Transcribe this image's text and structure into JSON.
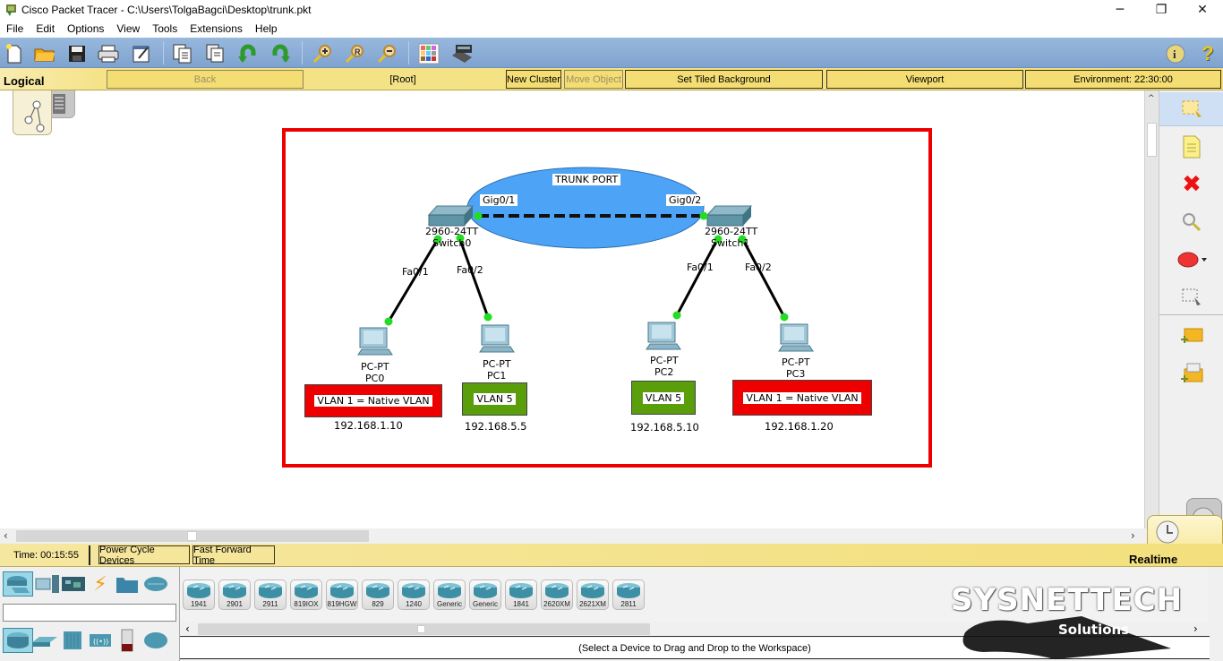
{
  "window": {
    "title": "Cisco Packet Tracer - C:\\Users\\TolgaBagci\\Desktop\\trunk.pkt",
    "controls": {
      "minimize": "─",
      "restore": "❐",
      "close": "✕"
    }
  },
  "menu": [
    "File",
    "Edit",
    "Options",
    "View",
    "Tools",
    "Extensions",
    "Help"
  ],
  "toolbar": {
    "buttons": [
      "new-file",
      "open-folder",
      "save",
      "print",
      "activity-wizard",
      "copy",
      "paste",
      "undo",
      "redo",
      "zoom-in",
      "zoom-reset",
      "zoom-out",
      "palette",
      "custom-device"
    ],
    "info_label": "i",
    "help_label": "?"
  },
  "logical_bar": {
    "label": "Logical",
    "back": "Back",
    "root": "[Root]",
    "new_cluster": "New Cluster",
    "move_object": "Move Object",
    "set_tiled_background": "Set Tiled Background",
    "viewport": "Viewport",
    "environment": "Environment: 22:30:00"
  },
  "topology": {
    "trunk_label": "TRUNK PORT",
    "switches": [
      {
        "model": "2960-24TT",
        "name": "Switch0",
        "uplink": "Gig0/1",
        "ports": [
          "Fa0/1",
          "Fa0/2"
        ]
      },
      {
        "model": "2960-24TT",
        "name": "Switch1",
        "uplink": "Gig0/2",
        "ports": [
          "Fa0/1",
          "Fa0/2"
        ]
      }
    ],
    "pcs": [
      {
        "model": "PC-PT",
        "name": "PC0",
        "vlan": "VLAN 1 = Native VLAN",
        "ip": "192.168.1.10",
        "color": "#ee0000"
      },
      {
        "model": "PC-PT",
        "name": "PC1",
        "vlan": "VLAN 5",
        "ip": "192.168.5.5",
        "color": "#5a9e0c"
      },
      {
        "model": "PC-PT",
        "name": "PC2",
        "vlan": "VLAN 5",
        "ip": "192.168.5.10",
        "color": "#5a9e0c"
      },
      {
        "model": "PC-PT",
        "name": "PC3",
        "vlan": "VLAN 1 = Native VLAN",
        "ip": "192.168.1.20",
        "color": "#ee0000"
      }
    ],
    "colors": {
      "frame": "#ee0000",
      "trunk_ellipse": "#4da3f5",
      "link_up": "#22dd22"
    }
  },
  "right_tools": [
    "select",
    "note",
    "delete",
    "inspect",
    "draw-ellipse",
    "resize",
    "add-simple-pdu",
    "add-complex-pdu"
  ],
  "status": {
    "time": "Time: 00:15:55",
    "power_cycle": "Power Cycle Devices",
    "fast_forward": "Fast Forward Time",
    "mode": "Realtime"
  },
  "device_categories_top": [
    "network-devices",
    "end-devices",
    "components",
    "connections",
    "miscellaneous",
    "multiuser"
  ],
  "device_categories_bottom": [
    "routers",
    "switches",
    "hubs",
    "wireless",
    "security",
    "wan-emulation"
  ],
  "device_models": [
    "1941",
    "2901",
    "2911",
    "819IOX",
    "819HGW",
    "829",
    "1240",
    "Generic",
    "Generic",
    "1841",
    "2620XM",
    "2621XM",
    "2811"
  ],
  "device_hint": "(Select a Device to Drag and Drop to the Workspace)",
  "watermark": {
    "title": "SYSNETTECH",
    "subtitle": "Solutions"
  }
}
